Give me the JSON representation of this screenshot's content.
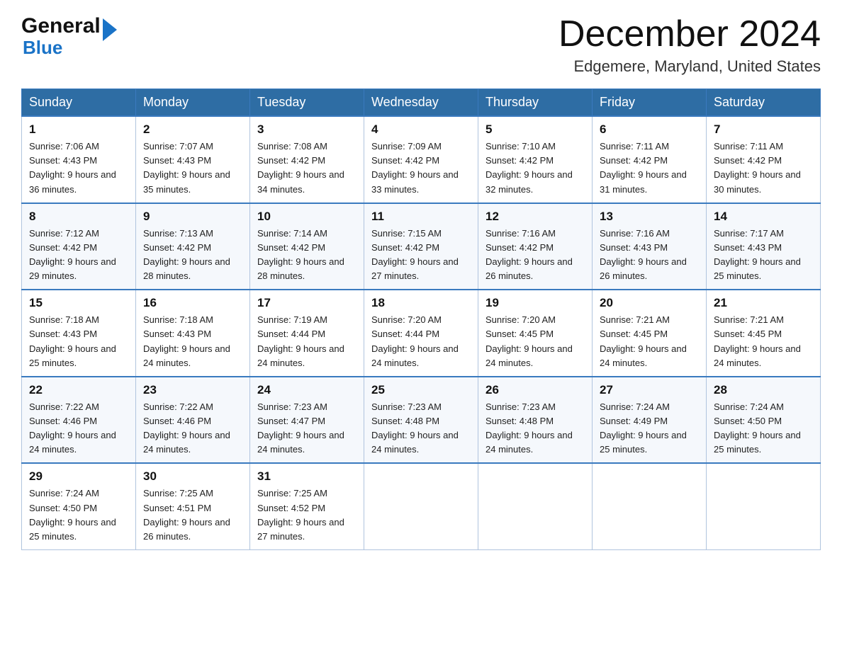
{
  "header": {
    "logo": {
      "general": "General",
      "arrow": "▶",
      "blue": "Blue"
    },
    "title": "December 2024",
    "location": "Edgemere, Maryland, United States"
  },
  "days_of_week": [
    "Sunday",
    "Monday",
    "Tuesday",
    "Wednesday",
    "Thursday",
    "Friday",
    "Saturday"
  ],
  "weeks": [
    [
      {
        "day": "1",
        "sunrise": "7:06 AM",
        "sunset": "4:43 PM",
        "daylight": "9 hours and 36 minutes."
      },
      {
        "day": "2",
        "sunrise": "7:07 AM",
        "sunset": "4:43 PM",
        "daylight": "9 hours and 35 minutes."
      },
      {
        "day": "3",
        "sunrise": "7:08 AM",
        "sunset": "4:42 PM",
        "daylight": "9 hours and 34 minutes."
      },
      {
        "day": "4",
        "sunrise": "7:09 AM",
        "sunset": "4:42 PM",
        "daylight": "9 hours and 33 minutes."
      },
      {
        "day": "5",
        "sunrise": "7:10 AM",
        "sunset": "4:42 PM",
        "daylight": "9 hours and 32 minutes."
      },
      {
        "day": "6",
        "sunrise": "7:11 AM",
        "sunset": "4:42 PM",
        "daylight": "9 hours and 31 minutes."
      },
      {
        "day": "7",
        "sunrise": "7:11 AM",
        "sunset": "4:42 PM",
        "daylight": "9 hours and 30 minutes."
      }
    ],
    [
      {
        "day": "8",
        "sunrise": "7:12 AM",
        "sunset": "4:42 PM",
        "daylight": "9 hours and 29 minutes."
      },
      {
        "day": "9",
        "sunrise": "7:13 AM",
        "sunset": "4:42 PM",
        "daylight": "9 hours and 28 minutes."
      },
      {
        "day": "10",
        "sunrise": "7:14 AM",
        "sunset": "4:42 PM",
        "daylight": "9 hours and 28 minutes."
      },
      {
        "day": "11",
        "sunrise": "7:15 AM",
        "sunset": "4:42 PM",
        "daylight": "9 hours and 27 minutes."
      },
      {
        "day": "12",
        "sunrise": "7:16 AM",
        "sunset": "4:42 PM",
        "daylight": "9 hours and 26 minutes."
      },
      {
        "day": "13",
        "sunrise": "7:16 AM",
        "sunset": "4:43 PM",
        "daylight": "9 hours and 26 minutes."
      },
      {
        "day": "14",
        "sunrise": "7:17 AM",
        "sunset": "4:43 PM",
        "daylight": "9 hours and 25 minutes."
      }
    ],
    [
      {
        "day": "15",
        "sunrise": "7:18 AM",
        "sunset": "4:43 PM",
        "daylight": "9 hours and 25 minutes."
      },
      {
        "day": "16",
        "sunrise": "7:18 AM",
        "sunset": "4:43 PM",
        "daylight": "9 hours and 24 minutes."
      },
      {
        "day": "17",
        "sunrise": "7:19 AM",
        "sunset": "4:44 PM",
        "daylight": "9 hours and 24 minutes."
      },
      {
        "day": "18",
        "sunrise": "7:20 AM",
        "sunset": "4:44 PM",
        "daylight": "9 hours and 24 minutes."
      },
      {
        "day": "19",
        "sunrise": "7:20 AM",
        "sunset": "4:45 PM",
        "daylight": "9 hours and 24 minutes."
      },
      {
        "day": "20",
        "sunrise": "7:21 AM",
        "sunset": "4:45 PM",
        "daylight": "9 hours and 24 minutes."
      },
      {
        "day": "21",
        "sunrise": "7:21 AM",
        "sunset": "4:45 PM",
        "daylight": "9 hours and 24 minutes."
      }
    ],
    [
      {
        "day": "22",
        "sunrise": "7:22 AM",
        "sunset": "4:46 PM",
        "daylight": "9 hours and 24 minutes."
      },
      {
        "day": "23",
        "sunrise": "7:22 AM",
        "sunset": "4:46 PM",
        "daylight": "9 hours and 24 minutes."
      },
      {
        "day": "24",
        "sunrise": "7:23 AM",
        "sunset": "4:47 PM",
        "daylight": "9 hours and 24 minutes."
      },
      {
        "day": "25",
        "sunrise": "7:23 AM",
        "sunset": "4:48 PM",
        "daylight": "9 hours and 24 minutes."
      },
      {
        "day": "26",
        "sunrise": "7:23 AM",
        "sunset": "4:48 PM",
        "daylight": "9 hours and 24 minutes."
      },
      {
        "day": "27",
        "sunrise": "7:24 AM",
        "sunset": "4:49 PM",
        "daylight": "9 hours and 25 minutes."
      },
      {
        "day": "28",
        "sunrise": "7:24 AM",
        "sunset": "4:50 PM",
        "daylight": "9 hours and 25 minutes."
      }
    ],
    [
      {
        "day": "29",
        "sunrise": "7:24 AM",
        "sunset": "4:50 PM",
        "daylight": "9 hours and 25 minutes."
      },
      {
        "day": "30",
        "sunrise": "7:25 AM",
        "sunset": "4:51 PM",
        "daylight": "9 hours and 26 minutes."
      },
      {
        "day": "31",
        "sunrise": "7:25 AM",
        "sunset": "4:52 PM",
        "daylight": "9 hours and 27 minutes."
      },
      null,
      null,
      null,
      null
    ]
  ]
}
